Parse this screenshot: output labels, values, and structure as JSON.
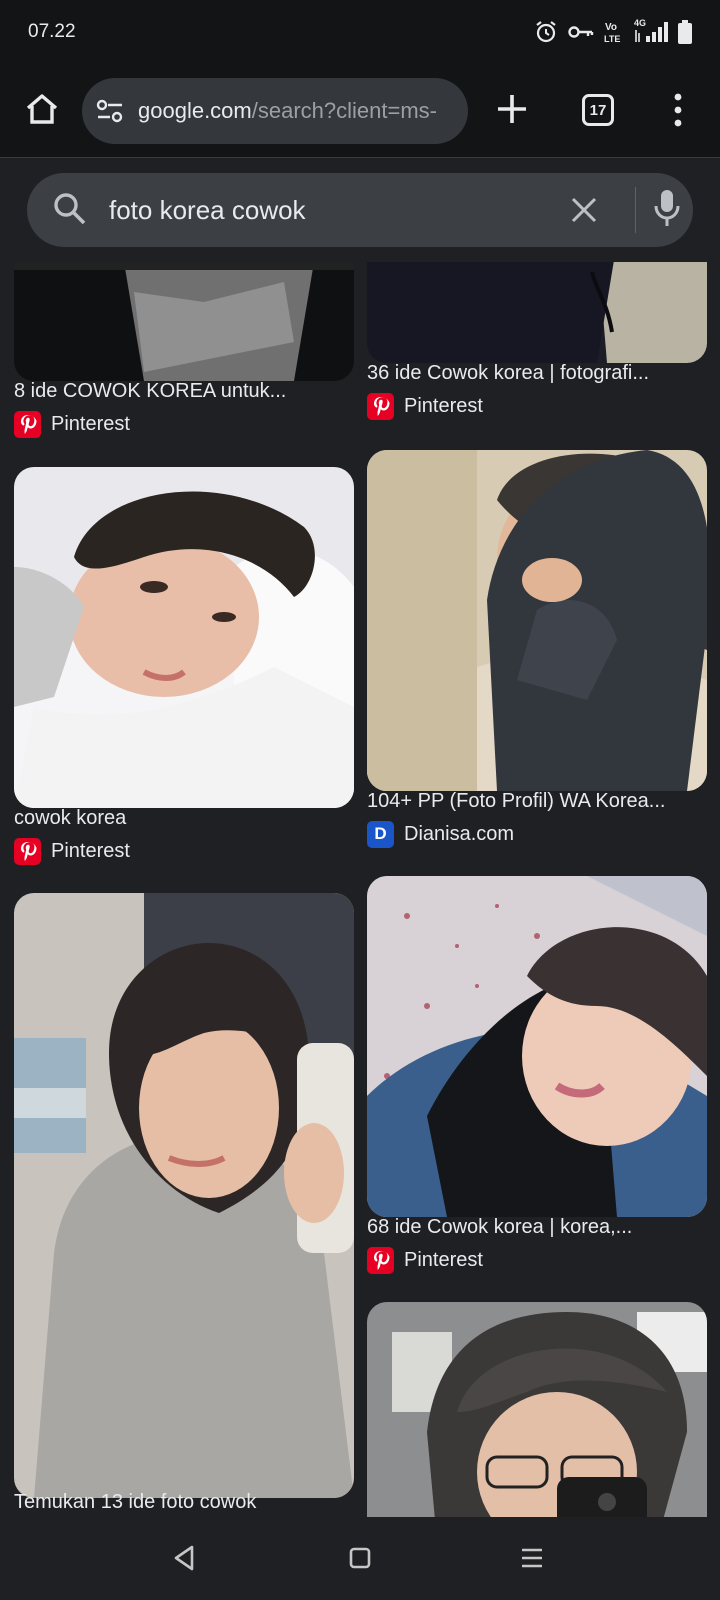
{
  "status": {
    "time": "07.22",
    "network": "4G"
  },
  "browser": {
    "url_domain": "google.com",
    "url_path": "/search?client=ms-",
    "tab_count": "17"
  },
  "search": {
    "query": "foto korea cowok"
  },
  "results": [
    {
      "title": "8 ide COWOK KOREA untuk...",
      "source": "Pinterest",
      "favicon": "pinterest-icon"
    },
    {
      "title": "36 ide Cowok korea | fotografi...",
      "source": "Pinterest",
      "favicon": "pinterest-icon"
    },
    {
      "title": "cowok korea",
      "source": "Pinterest",
      "favicon": "pinterest-icon"
    },
    {
      "title": "104+ PP (Foto Profil) WA Korea...",
      "source": "Dianisa.com",
      "favicon": "dianisa-icon"
    },
    {
      "title": "Temukan 13 ide foto cowok",
      "source": "",
      "favicon": ""
    },
    {
      "title": "68 ide Cowok korea | korea,...",
      "source": "Pinterest",
      "favicon": "pinterest-icon"
    },
    {
      "title": "",
      "source": "",
      "favicon": ""
    }
  ],
  "dianisa_letter": "D"
}
